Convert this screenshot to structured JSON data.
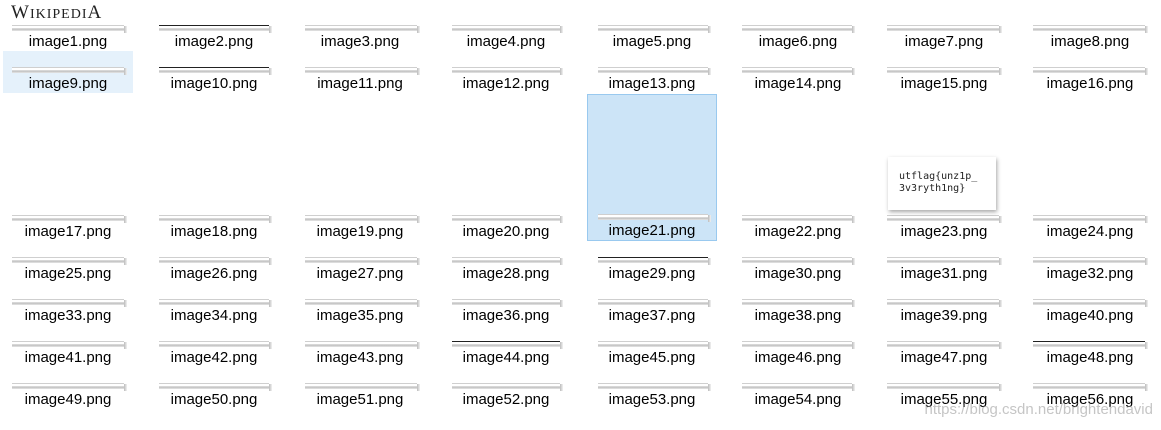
{
  "logo": {
    "text_big": "W",
    "text_small": "IKIPEDI",
    "text_end": "A"
  },
  "flag_card": {
    "line1": "utflag{unz1p_",
    "line2": "3v3ryth1ng}"
  },
  "watermark": "https://blog.csdn.net/brightendavid",
  "files": [
    "image1.png",
    "image2.png",
    "image3.png",
    "image4.png",
    "image5.png",
    "image6.png",
    "image7.png",
    "image8.png",
    "image9.png",
    "image10.png",
    "image11.png",
    "image12.png",
    "image13.png",
    "image14.png",
    "image15.png",
    "image16.png",
    "image17.png",
    "image18.png",
    "image19.png",
    "image20.png",
    "image21.png",
    "image22.png",
    "image23.png",
    "image24.png",
    "image25.png",
    "image26.png",
    "image27.png",
    "image28.png",
    "image29.png",
    "image30.png",
    "image31.png",
    "image32.png",
    "image33.png",
    "image34.png",
    "image35.png",
    "image36.png",
    "image37.png",
    "image38.png",
    "image39.png",
    "image40.png",
    "image41.png",
    "image42.png",
    "image43.png",
    "image44.png",
    "image45.png",
    "image46.png",
    "image47.png",
    "image48.png",
    "image49.png",
    "image50.png",
    "image51.png",
    "image52.png",
    "image53.png",
    "image54.png",
    "image55.png",
    "image56.png"
  ],
  "selection": {
    "hover_item": "image9.png",
    "selected_item": "image21.png"
  }
}
